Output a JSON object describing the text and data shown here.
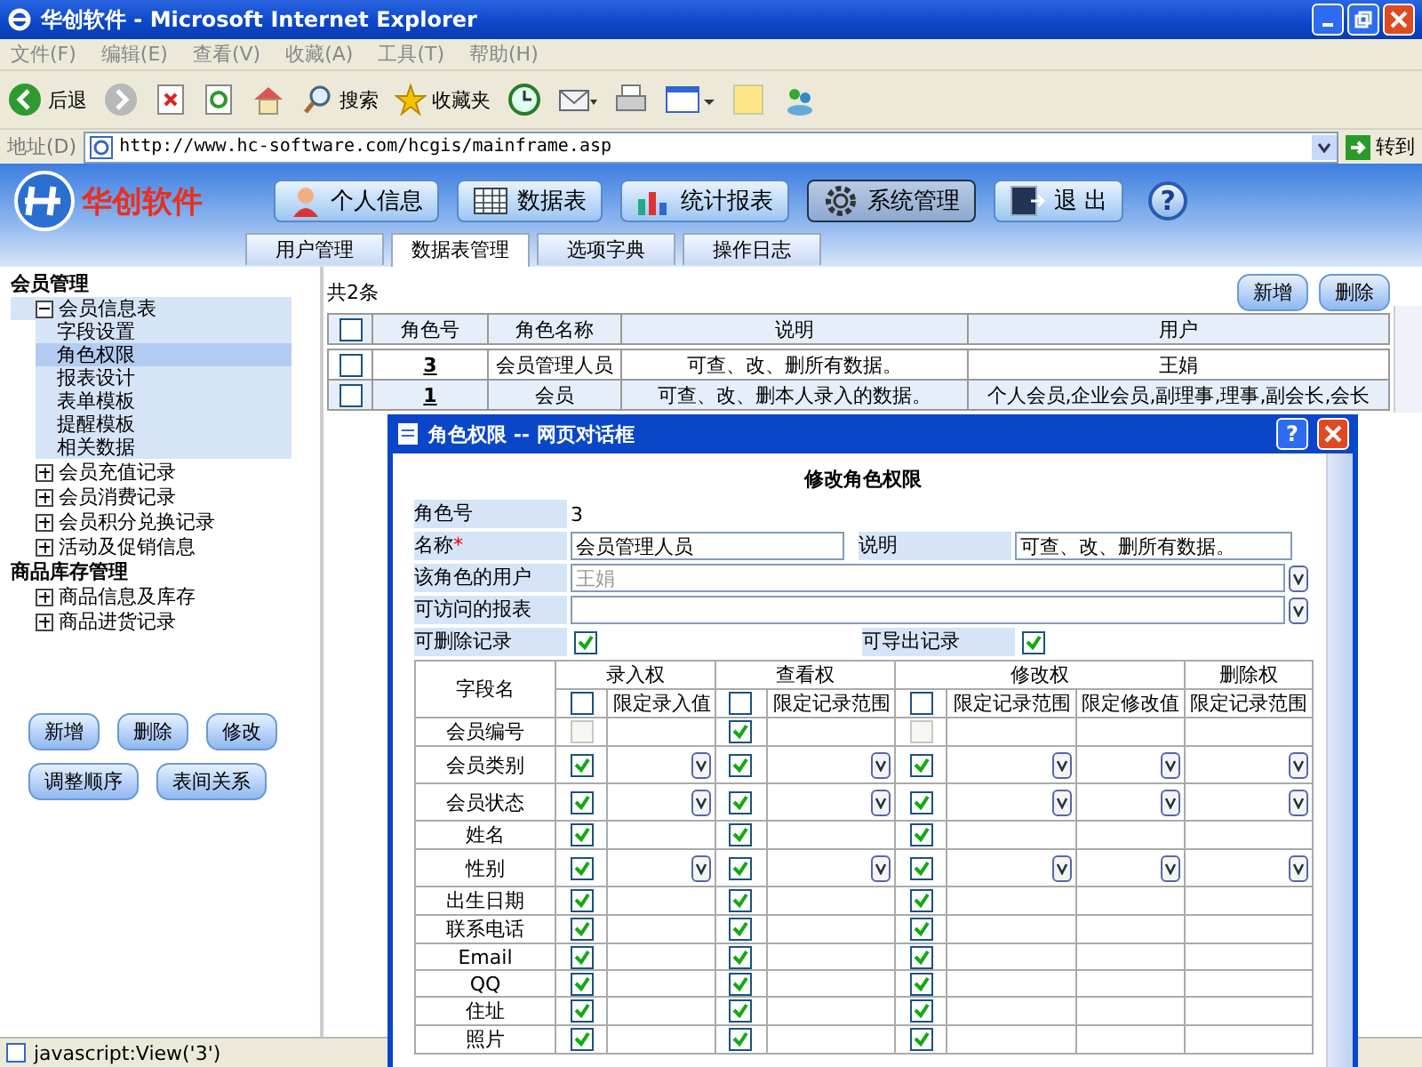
{
  "window": {
    "title": "华创软件 - Microsoft Internet Explorer"
  },
  "menu": [
    "文件(F)",
    "编辑(E)",
    "查看(V)",
    "收藏(A)",
    "工具(T)",
    "帮助(H)"
  ],
  "toolbar": {
    "back": "后退",
    "search": "搜索",
    "favorites": "收藏夹"
  },
  "address": {
    "label": "地址(D)",
    "url": "http://www.hc-software.com/hcgis/mainframe.asp",
    "go": "转到"
  },
  "app": {
    "logo": "华创软件",
    "help": "?",
    "nav": [
      {
        "label": "个人信息",
        "selected": false
      },
      {
        "label": "数据表",
        "selected": false
      },
      {
        "label": "统计报表",
        "selected": false
      },
      {
        "label": "系统管理",
        "selected": true
      },
      {
        "label": "退 出",
        "selected": false
      }
    ]
  },
  "tabs": [
    {
      "label": "用户管理",
      "selected": false
    },
    {
      "label": "数据表管理",
      "selected": true
    },
    {
      "label": "选项字典",
      "selected": false
    },
    {
      "label": "操作日志",
      "selected": false
    }
  ],
  "sidebar": {
    "groups": [
      {
        "label": "会员管理",
        "children": [
          {
            "label": "会员信息表",
            "expanded": true,
            "children": [
              {
                "label": "字段设置",
                "selected": false
              },
              {
                "label": "角色权限",
                "selected": true
              },
              {
                "label": "报表设计",
                "selected": false
              },
              {
                "label": "表单模板",
                "selected": false
              },
              {
                "label": "提醒模板",
                "selected": false
              },
              {
                "label": "相关数据",
                "selected": false
              }
            ]
          },
          {
            "label": "会员充值记录",
            "expanded": false
          },
          {
            "label": "会员消费记录",
            "expanded": false
          },
          {
            "label": "会员积分兑换记录",
            "expanded": false
          },
          {
            "label": "活动及促销信息",
            "expanded": false
          }
        ]
      },
      {
        "label": "商品库存管理",
        "children": [
          {
            "label": "商品信息及库存",
            "expanded": false
          },
          {
            "label": "商品进货记录",
            "expanded": false
          }
        ]
      }
    ],
    "buttons": [
      [
        "新增",
        "删除",
        "修改"
      ],
      [
        "调整顺序",
        "表间关系"
      ]
    ]
  },
  "table": {
    "count": "共2条",
    "buttons": [
      "新增",
      "删除"
    ],
    "header_checked": false,
    "columns": [
      "角色号",
      "角色名称",
      "说明",
      "用户"
    ],
    "rows": [
      {
        "checked": false,
        "id": "3",
        "name": "会员管理人员",
        "description": "可查、改、删所有数据。",
        "users": "王娟"
      },
      {
        "checked": false,
        "id": "1",
        "name": "会员",
        "description": "可查、改、删本人录入的数据。",
        "users": "个人会员,企业会员,副理事,理事,副会长,会长"
      }
    ]
  },
  "dialog": {
    "title": "角色权限 -- 网页对话框",
    "heading": "修改角色权限",
    "role_id": {
      "label": "角色号",
      "value": "3"
    },
    "name": {
      "label": "名称",
      "required_mark": "*",
      "value": "会员管理人员"
    },
    "description": {
      "label": "说明",
      "value": "可查、改、删所有数据。"
    },
    "users": {
      "label": "该角色的用户",
      "value": "王娟"
    },
    "reports": {
      "label": "可访问的报表"
    },
    "can_delete": {
      "label": "可删除记录",
      "checked": true
    },
    "can_export": {
      "label": "可导出记录",
      "checked": true
    },
    "grid": {
      "field_column": "字段名",
      "groups": [
        {
          "label": "录入权",
          "checked": false,
          "sub": [
            "限定录入值"
          ]
        },
        {
          "label": "查看权",
          "checked": false,
          "sub": [
            "限定记录范围"
          ]
        },
        {
          "label": "修改权",
          "checked": false,
          "sub": [
            "限定记录范围",
            "限定修改值"
          ]
        },
        {
          "label": "删除权",
          "sub": [
            "限定记录范围"
          ]
        }
      ],
      "rows": [
        {
          "field": "会员编号",
          "dropdowns": false,
          "checks": [
            {
              "checked": false,
              "disabled": true
            },
            {
              "checked": true,
              "disabled": false
            },
            {
              "checked": false,
              "disabled": true
            }
          ]
        },
        {
          "field": "会员类别",
          "dropdowns": true,
          "checks": [
            {
              "checked": true,
              "disabled": false
            },
            {
              "checked": true,
              "disabled": false
            },
            {
              "checked": true,
              "disabled": false
            }
          ]
        },
        {
          "field": "会员状态",
          "dropdowns": true,
          "checks": [
            {
              "checked": true,
              "disabled": false
            },
            {
              "checked": true,
              "disabled": false
            },
            {
              "checked": true,
              "disabled": false
            }
          ]
        },
        {
          "field": "姓名",
          "dropdowns": false,
          "checks": [
            {
              "checked": true,
              "disabled": false
            },
            {
              "checked": true,
              "disabled": false
            },
            {
              "checked": true,
              "disabled": false
            }
          ]
        },
        {
          "field": "性别",
          "dropdowns": true,
          "checks": [
            {
              "checked": true,
              "disabled": false
            },
            {
              "checked": true,
              "disabled": false
            },
            {
              "checked": true,
              "disabled": false
            }
          ]
        },
        {
          "field": "出生日期",
          "dropdowns": false,
          "checks": [
            {
              "checked": true,
              "disabled": false
            },
            {
              "checked": true,
              "disabled": false
            },
            {
              "checked": true,
              "disabled": false
            }
          ]
        },
        {
          "field": "联系电话",
          "dropdowns": false,
          "checks": [
            {
              "checked": true,
              "disabled": false
            },
            {
              "checked": true,
              "disabled": false
            },
            {
              "checked": true,
              "disabled": false
            }
          ]
        },
        {
          "field": "Email",
          "dropdowns": false,
          "checks": [
            {
              "checked": true,
              "disabled": false
            },
            {
              "checked": true,
              "disabled": false
            },
            {
              "checked": true,
              "disabled": false
            }
          ]
        },
        {
          "field": "QQ",
          "dropdowns": false,
          "checks": [
            {
              "checked": true,
              "disabled": false
            },
            {
              "checked": true,
              "disabled": false
            },
            {
              "checked": true,
              "disabled": false
            }
          ]
        },
        {
          "field": "住址",
          "dropdowns": false,
          "checks": [
            {
              "checked": true,
              "disabled": false
            },
            {
              "checked": true,
              "disabled": false
            },
            {
              "checked": true,
              "disabled": false
            }
          ]
        },
        {
          "field": "照片",
          "dropdowns": false,
          "checks": [
            {
              "checked": true,
              "disabled": false
            },
            {
              "checked": true,
              "disabled": false
            },
            {
              "checked": true,
              "disabled": false
            }
          ]
        }
      ]
    }
  },
  "status_bar": "javascript:View('3')"
}
